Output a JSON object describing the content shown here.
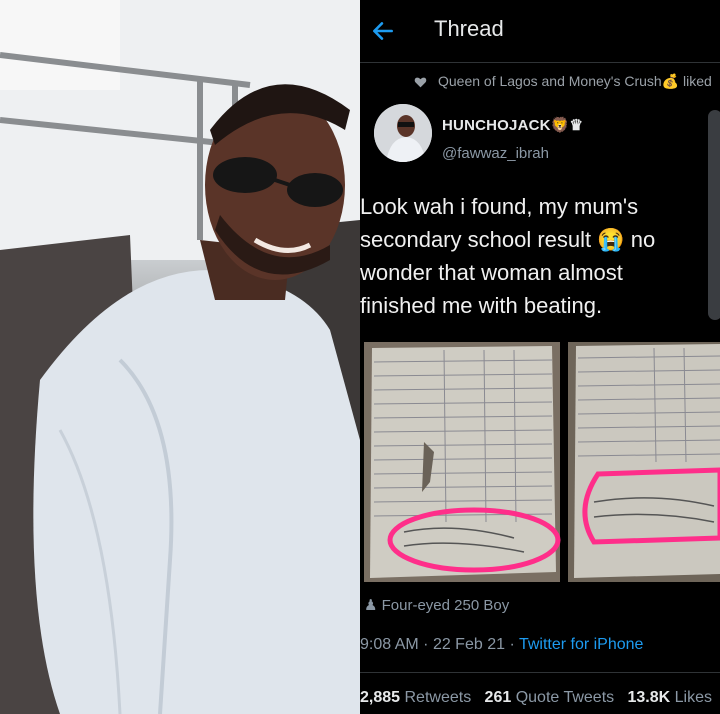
{
  "header": {
    "title": "Thread"
  },
  "social_context": {
    "text": "Queen of Lagos and Money's Crush💰 liked"
  },
  "author": {
    "name": "HUNCHOJACK🦁♛",
    "handle": "@fawwaz_ibrah"
  },
  "tweet": {
    "text_line1": "Look wah i found, my mum's",
    "text_line2": "secondary school result 😭 no",
    "text_line3": "wonder that woman almost",
    "text_line4": "finished me with beating."
  },
  "media": {
    "caption": "Four-eyed 250 Boy"
  },
  "meta": {
    "time": "9:08 AM",
    "date": "22 Feb 21",
    "source": "Twitter for iPhone"
  },
  "stats": {
    "retweets_count": "2,885",
    "retweets_label": "Retweets",
    "quotes_count": "261",
    "quotes_label": "Quote Tweets",
    "likes_count": "13.8K",
    "likes_label": "Likes"
  },
  "colors": {
    "background": "#000000",
    "link": "#1d9bf0",
    "muted": "#8b98a5",
    "highlight": "#ff2e8a"
  },
  "icons": {
    "back": "arrow-left-icon",
    "like": "heart-icon",
    "media_caption": "person-icon"
  }
}
